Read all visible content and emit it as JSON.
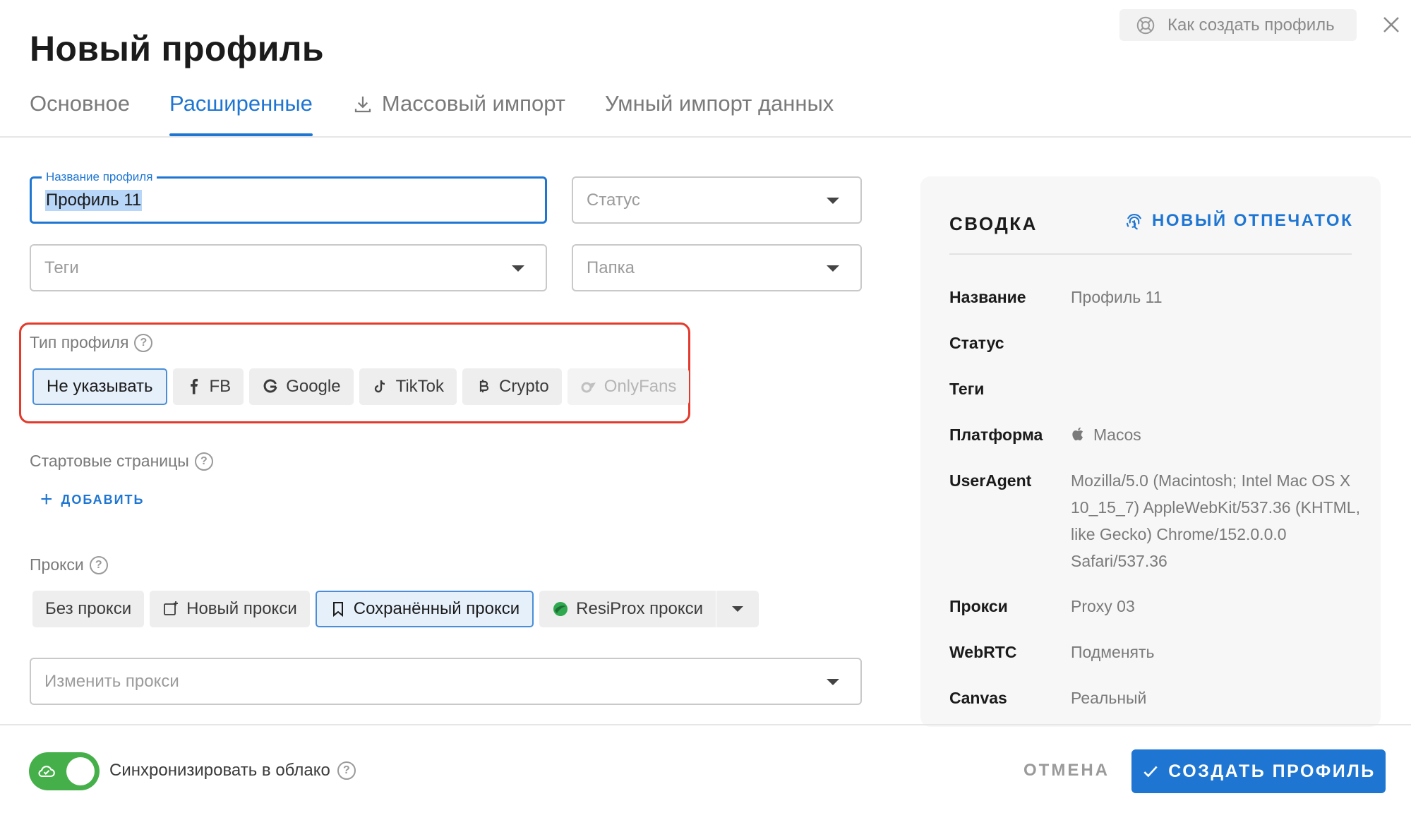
{
  "header": {
    "title": "Новый профиль",
    "help_label": "Как создать профиль"
  },
  "tabs": [
    {
      "label": "Основное",
      "active": false
    },
    {
      "label": "Расширенные",
      "active": true
    },
    {
      "label": "Массовый импорт",
      "active": false,
      "icon": "download-icon"
    },
    {
      "label": "Умный импорт данных",
      "active": false
    }
  ],
  "form": {
    "profile_name": {
      "label": "Название профиля",
      "value": "Профиль 11"
    },
    "status": {
      "placeholder": "Статус"
    },
    "tags": {
      "placeholder": "Теги"
    },
    "folder": {
      "placeholder": "Папка"
    },
    "profile_type": {
      "label": "Тип профиля",
      "options": [
        {
          "label": "Не указывать",
          "selected": true
        },
        {
          "label": "FB",
          "icon": "facebook-icon"
        },
        {
          "label": "Google",
          "icon": "google-icon"
        },
        {
          "label": "TikTok",
          "icon": "tiktok-icon"
        },
        {
          "label": "Crypto",
          "icon": "bitcoin-icon"
        },
        {
          "label": "OnlyFans",
          "icon": "onlyfans-icon",
          "disabled": true
        }
      ]
    },
    "start_pages": {
      "label": "Стартовые страницы",
      "add_label": "ДОБАВИТЬ"
    },
    "proxy": {
      "label": "Прокси",
      "options": [
        {
          "label": "Без прокси"
        },
        {
          "label": "Новый прокси",
          "icon": "new-proxy-icon"
        },
        {
          "label": "Сохранённый прокси",
          "icon": "bookmark-icon",
          "selected": true
        },
        {
          "label": "ResiProx прокси",
          "icon": "resiprox-icon"
        }
      ],
      "change_placeholder": "Изменить прокси"
    }
  },
  "summary": {
    "title": "СВОДКА",
    "fingerprint_label": "НОВЫЙ ОТПЕЧАТОК",
    "rows": [
      {
        "key": "Название",
        "value": "Профиль 11"
      },
      {
        "key": "Статус",
        "value": ""
      },
      {
        "key": "Теги",
        "value": ""
      },
      {
        "key": "Платформа",
        "value": "Macos",
        "icon": "apple-icon"
      },
      {
        "key": "UserAgent",
        "value": "Mozilla/5.0 (Macintosh; Intel Mac OS X 10_15_7) AppleWebKit/537.36 (KHTML, like Gecko) Chrome/152.0.0.0 Safari/537.36"
      },
      {
        "key": "Прокси",
        "value": "Proxy 03"
      },
      {
        "key": "WebRTC",
        "value": "Подменять"
      },
      {
        "key": "Canvas",
        "value": "Реальный"
      }
    ]
  },
  "footer": {
    "sync_label": "Синхронизировать в облако",
    "sync_enabled": true,
    "cancel_label": "ОТМЕНА",
    "create_label": "СОЗДАТЬ ПРОФИЛЬ"
  },
  "colors": {
    "accent": "#1f76d2",
    "highlight": "#e33a2c",
    "toggle_on": "#45b04a"
  }
}
